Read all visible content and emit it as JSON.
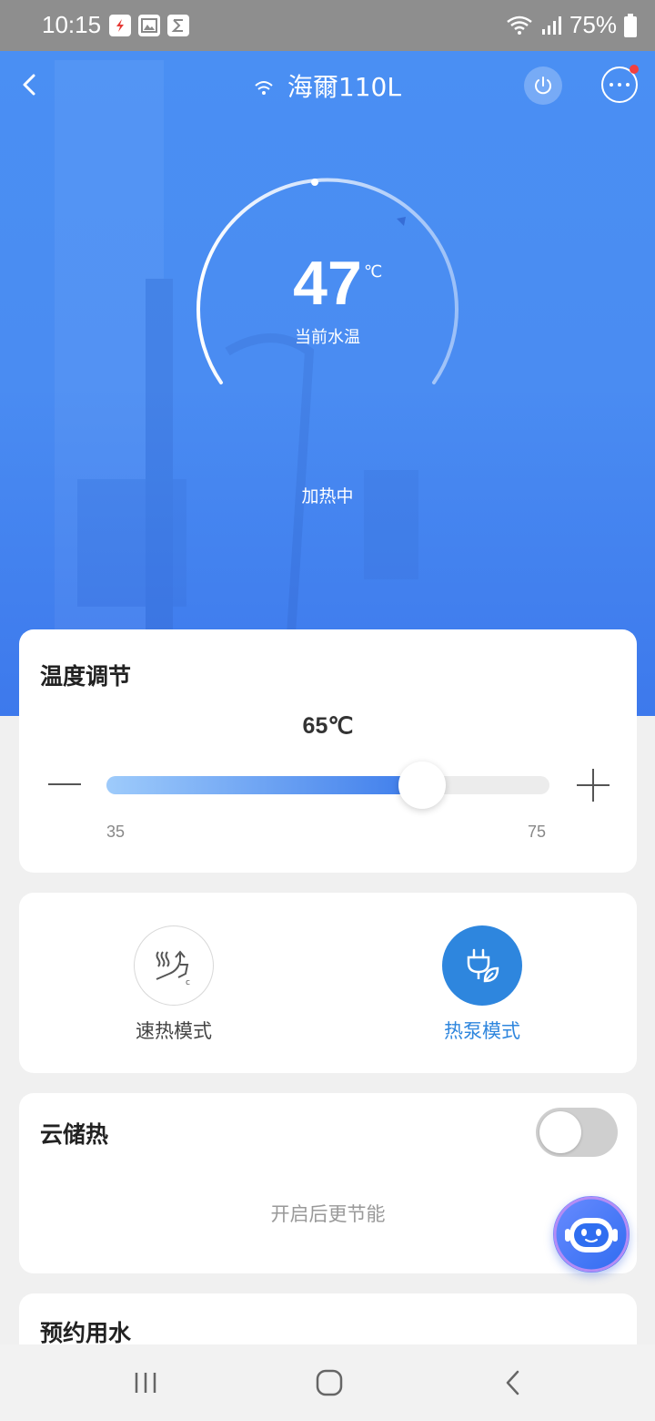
{
  "status_bar": {
    "time": "10:15",
    "battery": "75%"
  },
  "header": {
    "device_name": "海爾110L"
  },
  "gauge": {
    "current_temp": "47",
    "unit": "℃",
    "label": "当前水温",
    "heating_status": "加热中"
  },
  "temperature_card": {
    "title": "温度调节",
    "setpoint": "65℃",
    "setpoint_value": 65,
    "min": "35",
    "max": "75",
    "min_value": 35,
    "max_value": 75
  },
  "mode_card": {
    "modes": [
      {
        "label": "速热模式",
        "active": false,
        "icon": "quick-heat-icon"
      },
      {
        "label": "热泵模式",
        "active": true,
        "icon": "heat-pump-icon"
      }
    ]
  },
  "cloud_card": {
    "title": "云储热",
    "toggle_on": false,
    "hint": "开启后更节能"
  },
  "appointment_card": {
    "title": "预约用水"
  },
  "colors": {
    "accent": "#2e86de",
    "hero_bg": "#4a8cf2"
  }
}
